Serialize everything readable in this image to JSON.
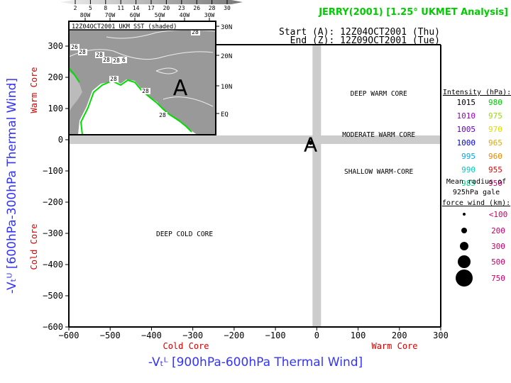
{
  "chart_data": {
    "type": "scatter",
    "title": "JERRY(2001) [1.25° UKMET Analysis]",
    "subtitle_start": "Start (A): 12Z04OCT2001 (Thu)",
    "subtitle_end": "End (Z): 12Z09OCT2001 (Tue)",
    "xlabel": "-Vₜᴸ [900hPa-600hPa Thermal Wind]",
    "ylabel": "-Vₜᵁ [600hPa-300hPa Thermal Wind]",
    "xlim": [
      -600,
      300
    ],
    "ylim": [
      -600,
      300
    ],
    "x_ticks": [
      -600,
      -500,
      -400,
      -300,
      -200,
      -100,
      0,
      100,
      200,
      300
    ],
    "y_ticks": [
      -600,
      -500,
      -400,
      -300,
      -200,
      -100,
      0,
      100,
      200,
      300
    ],
    "x_side_labels": {
      "negative": "Cold Core",
      "positive": "Warm Core"
    },
    "y_side_labels": {
      "negative": "Cold Core",
      "positive": "Warm Core"
    },
    "region_labels": [
      {
        "text": "DEEP WARM CORE",
        "x": 150,
        "y": 150
      },
      {
        "text": "MODERATE WARM CORE",
        "x": 150,
        "y": 18
      },
      {
        "text": "SHALLOW WARM-CORE",
        "x": 150,
        "y": -100
      },
      {
        "text": "DEEP COLD CORE",
        "x": -320,
        "y": -300
      }
    ],
    "points": [
      {
        "label": "A",
        "x": -15,
        "y": -10,
        "pressure_hPa": 1015,
        "gale_radius_km": 100
      }
    ],
    "intensity_legend": {
      "title": "Intensity (hPa):",
      "entries": [
        {
          "value": "1015",
          "color": "#000000"
        },
        {
          "value": "980",
          "color": "#00cc00"
        },
        {
          "value": "1010",
          "color": "#9900cc"
        },
        {
          "value": "975",
          "color": "#99dd00"
        },
        {
          "value": "1005",
          "color": "#6600cc"
        },
        {
          "value": "970",
          "color": "#dddd00"
        },
        {
          "value": "1000",
          "color": "#0000ff"
        },
        {
          "value": "965",
          "color": "#ddaa00"
        },
        {
          "value": "995",
          "color": "#00aaee"
        },
        {
          "value": "960",
          "color": "#ee8800"
        },
        {
          "value": "990",
          "color": "#00ccbb"
        },
        {
          "value": "955",
          "color": "#ee0000"
        },
        {
          "value": "985",
          "color": "#00cc88"
        },
        {
          "value": "950",
          "color": "#cc0066"
        }
      ]
    },
    "radius_legend": {
      "title_lines": [
        "Mean radius of",
        "925hPa gale",
        "force wind (km):"
      ],
      "entries": [
        "<100",
        "200",
        "300",
        "500",
        "750"
      ],
      "color": "#cc0066"
    },
    "inset": {
      "title": "12Z04OCT2001 UKM SST (shaded)",
      "lat_labels": [
        "30N",
        "20N",
        "10N",
        "EQ"
      ],
      "lon_labels": [
        "80W",
        "70W",
        "60W",
        "50W",
        "40W",
        "30W"
      ],
      "sst_scale": [
        "2",
        "5",
        "8",
        "11",
        "14",
        "17",
        "20",
        "23",
        "26",
        "28",
        "30"
      ],
      "contour_labels": [
        "26",
        "28",
        "28",
        "28",
        "26",
        "28",
        "28",
        "28",
        "28",
        "28"
      ],
      "storm_marker": "A"
    }
  }
}
